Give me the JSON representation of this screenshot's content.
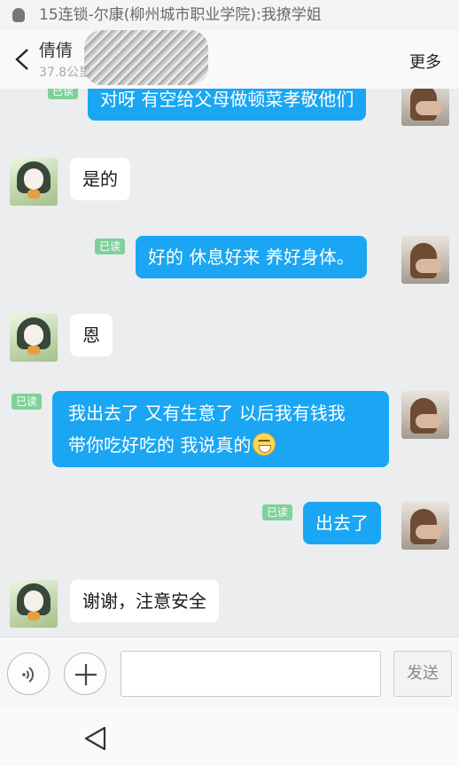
{
  "notification": {
    "icon": "qq-icon",
    "text": "15连锁-尔康(柳州城市职业学院):我撩学姐"
  },
  "header": {
    "contact_name": "倩倩",
    "subtitle": "37.8公里",
    "more_label": "更多"
  },
  "messages": [
    {
      "side": "right",
      "text": "对呀 有空给父母做顿菜孝敬他们",
      "read_label": "已读"
    },
    {
      "side": "left",
      "text": "是的"
    },
    {
      "side": "right",
      "text": "好的 休息好来 养好身体。",
      "read_label": "已读"
    },
    {
      "side": "left",
      "text": "恩"
    },
    {
      "side": "right",
      "line1": "我出去了 又有生意了 以后我有钱我",
      "line2": "带你吃好吃的 我说真的",
      "emoji": "grin-emoji",
      "read_label": "已读"
    },
    {
      "side": "right",
      "text": "出去了",
      "read_label": "已读"
    },
    {
      "side": "left",
      "text": "谢谢，注意安全"
    }
  ],
  "input_bar": {
    "voice_icon": "voice-icon",
    "plus_icon": "plus-icon",
    "input_value": "",
    "send_label": "发送"
  },
  "system_nav": {
    "back_icon": "triangle-back-icon"
  },
  "colors": {
    "accent": "#1aa6f2",
    "read_badge": "#7fd09a",
    "chat_bg": "#ebedee"
  }
}
